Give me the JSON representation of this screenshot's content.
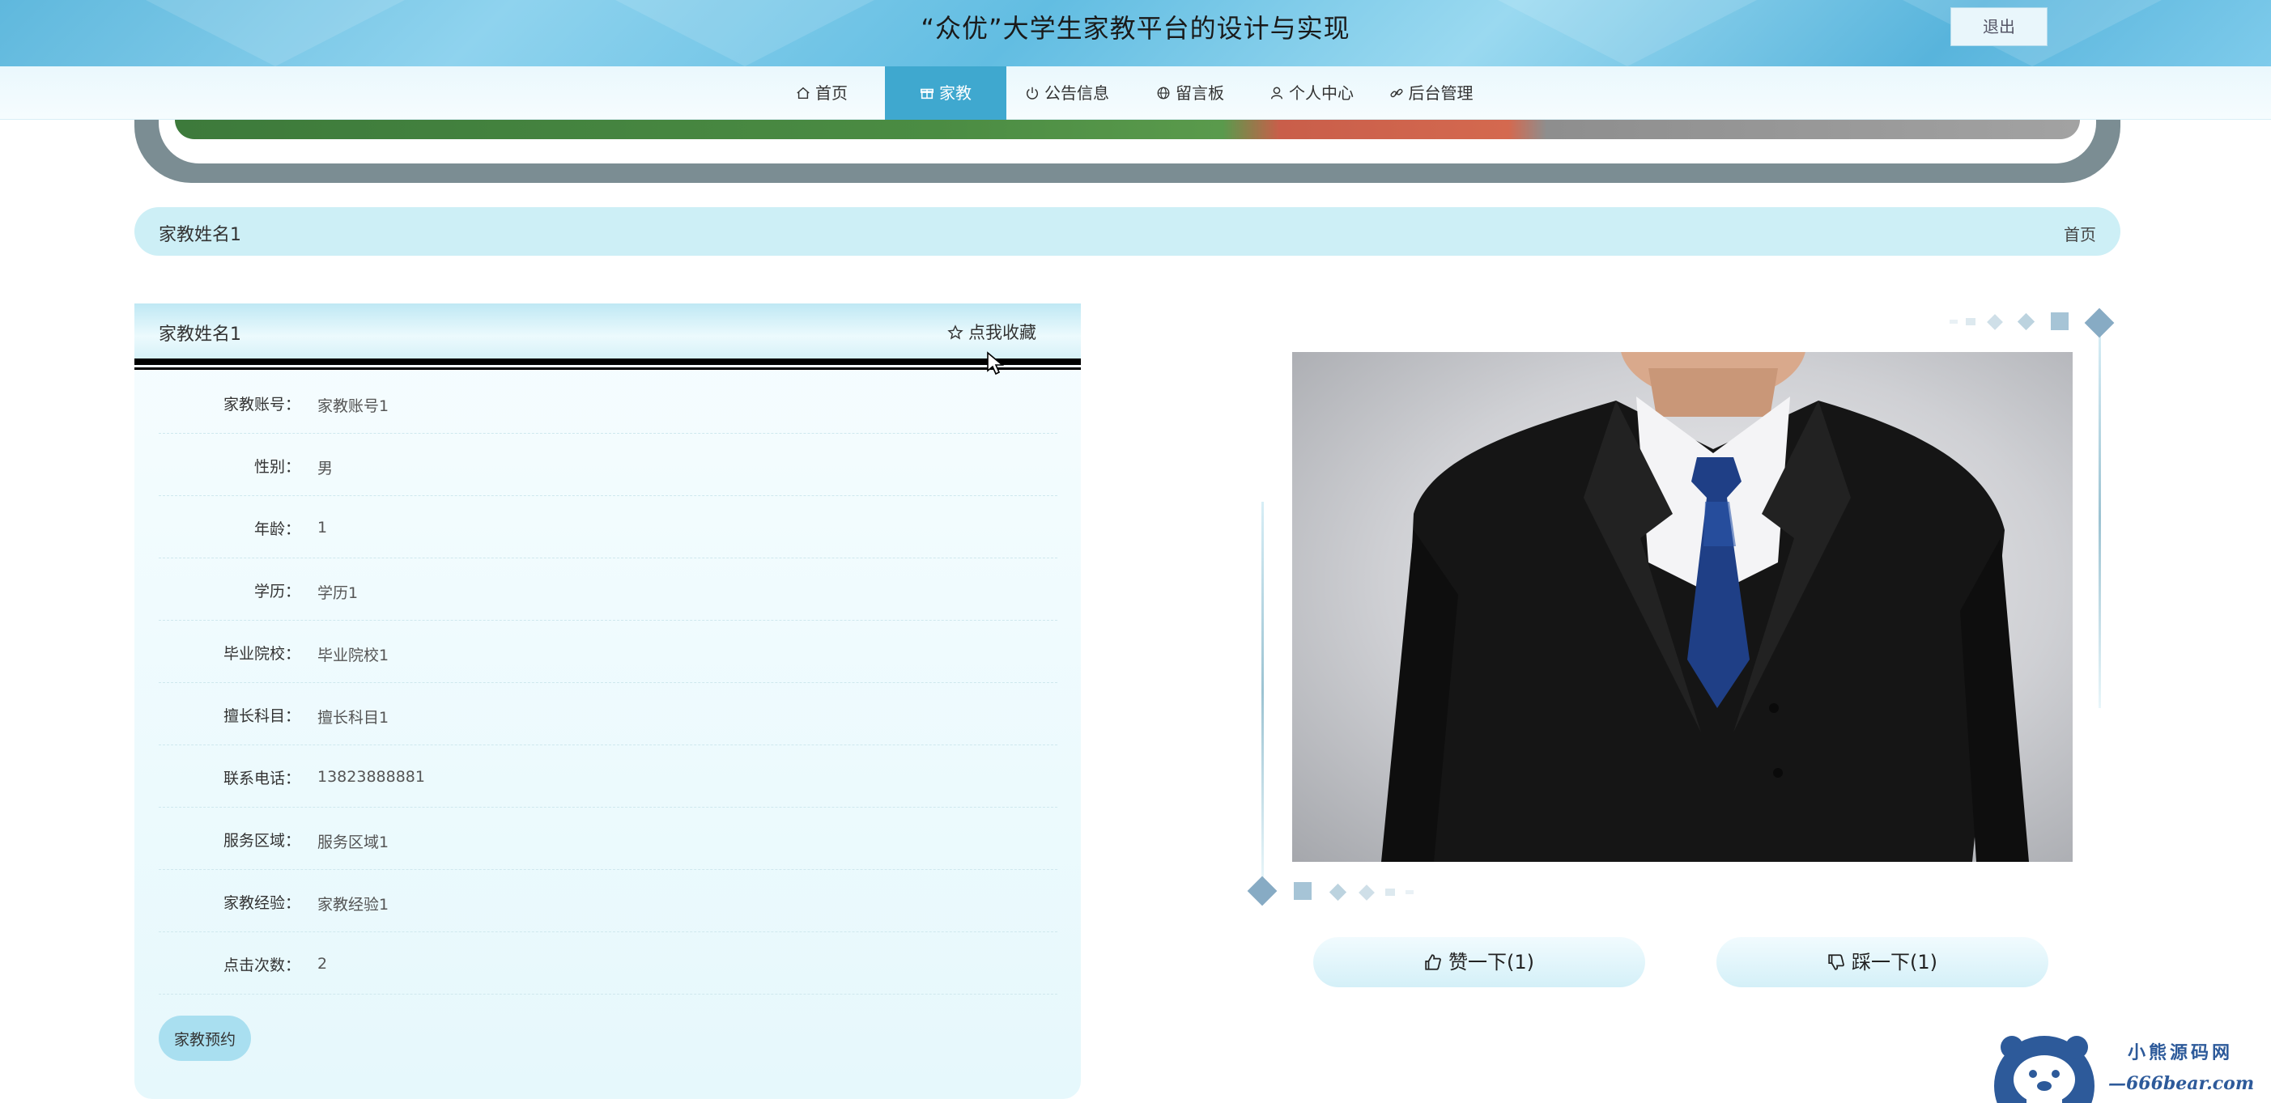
{
  "header": {
    "title": "“众优”大学生家教平台的设计与实现",
    "logout_label": "退出"
  },
  "nav": {
    "items": [
      {
        "label": "首页",
        "icon": "home-icon"
      },
      {
        "label": "家教",
        "icon": "gift-icon",
        "active": true
      },
      {
        "label": "公告信息",
        "icon": "power-icon"
      },
      {
        "label": "留言板",
        "icon": "globe-icon"
      },
      {
        "label": "个人中心",
        "icon": "user-icon"
      },
      {
        "label": "后台管理",
        "icon": "link-icon"
      }
    ]
  },
  "breadcrumb": {
    "title": "家教姓名1",
    "home": "首页"
  },
  "detail": {
    "title": "家教姓名1",
    "favorite_label": "点我收藏",
    "fields": [
      {
        "label": "家教账号：",
        "value": "家教账号1"
      },
      {
        "label": "性别：",
        "value": "男"
      },
      {
        "label": "年龄：",
        "value": "1"
      },
      {
        "label": "学历：",
        "value": "学历1"
      },
      {
        "label": "毕业院校：",
        "value": "毕业院校1"
      },
      {
        "label": "擅长科目：",
        "value": "擅长科目1"
      },
      {
        "label": "联系电话：",
        "value": "13823888881"
      },
      {
        "label": "服务区域：",
        "value": "服务区域1"
      },
      {
        "label": "家教经验：",
        "value": "家教经验1"
      },
      {
        "label": "点击次数：",
        "value": "2"
      }
    ],
    "book_label": "家教预约"
  },
  "votes": {
    "like_label": "赞一下(1)",
    "dislike_label": "踩一下(1)"
  },
  "watermark": {
    "line1": "小熊源码网",
    "line2": "—666bear.com—"
  },
  "colors": {
    "header_blue": "#5fb8dd",
    "nav_active": "#3fa8cf",
    "breadcrumb_bg": "#cdeff6",
    "panel_bg": "#e6f8fc"
  }
}
